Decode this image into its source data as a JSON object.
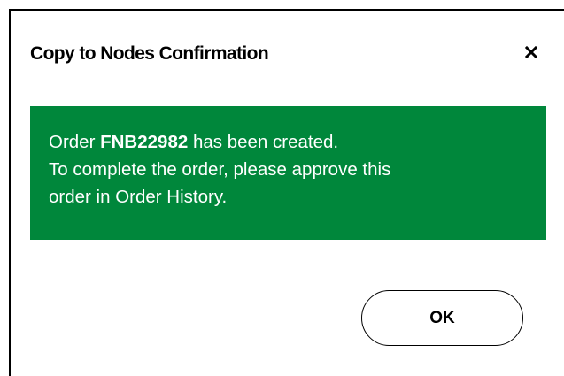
{
  "dialog": {
    "title": "Copy to Nodes Confirmation",
    "close_icon": "close-icon",
    "message": {
      "line1_prefix": "Order ",
      "order_number": "FNB22982",
      "line1_suffix": " has been created.",
      "line2": "To complete the order, please approve this",
      "line3": "order in Order History."
    },
    "ok_label": "OK"
  },
  "colors": {
    "notice_background": "#00873b",
    "notice_text": "#ffffff",
    "text": "#000000",
    "background": "#ffffff"
  }
}
